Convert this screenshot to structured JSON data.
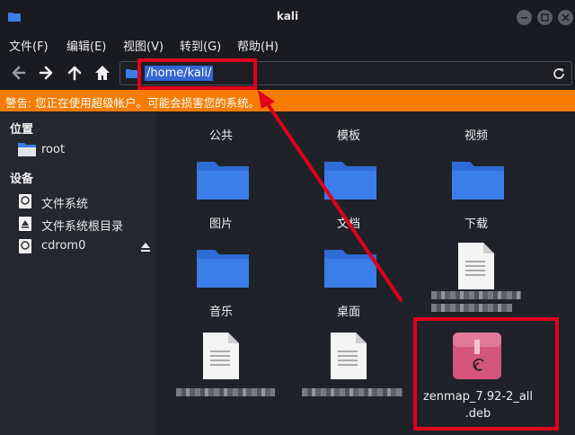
{
  "window": {
    "title": "kali"
  },
  "menu": [
    "文件(F)",
    "编辑(E)",
    "视图(V)",
    "转到(G)",
    "帮助(H)"
  ],
  "address": {
    "path": "/home/kali/"
  },
  "warning": "警告: 您正在使用超级帐户。可能会损害您的系统。",
  "sidebar": {
    "places_header": "位置",
    "devices_header": "设备",
    "places": [
      {
        "label": "root",
        "icon": "folder-icon"
      }
    ],
    "devices": [
      {
        "label": "文件系统",
        "icon": "drive-icon"
      },
      {
        "label": "文件系统根目录",
        "icon": "drive-icon"
      },
      {
        "label": "cdrom0",
        "icon": "disc-icon"
      }
    ]
  },
  "files": [
    {
      "name": "公共",
      "type": "folder"
    },
    {
      "name": "模板",
      "type": "folder"
    },
    {
      "name": "视频",
      "type": "folder"
    },
    {
      "name": "图片",
      "type": "folder"
    },
    {
      "name": "文档",
      "type": "folder"
    },
    {
      "name": "下载",
      "type": "folder"
    },
    {
      "name": "音乐",
      "type": "folder"
    },
    {
      "name": "桌面",
      "type": "folder"
    },
    {
      "name": "",
      "type": "document"
    },
    {
      "name": "",
      "type": "document"
    },
    {
      "name": "",
      "type": "document"
    },
    {
      "name_line1": "zenmap_7.92-2_all",
      "name_line2": ".deb",
      "type": "deb-package"
    }
  ],
  "colors": {
    "warning": "#f57c00",
    "folder": "#3b7de9",
    "selection": "#3465d3",
    "annotation": "#e0001b",
    "deb": "#d4567c"
  }
}
